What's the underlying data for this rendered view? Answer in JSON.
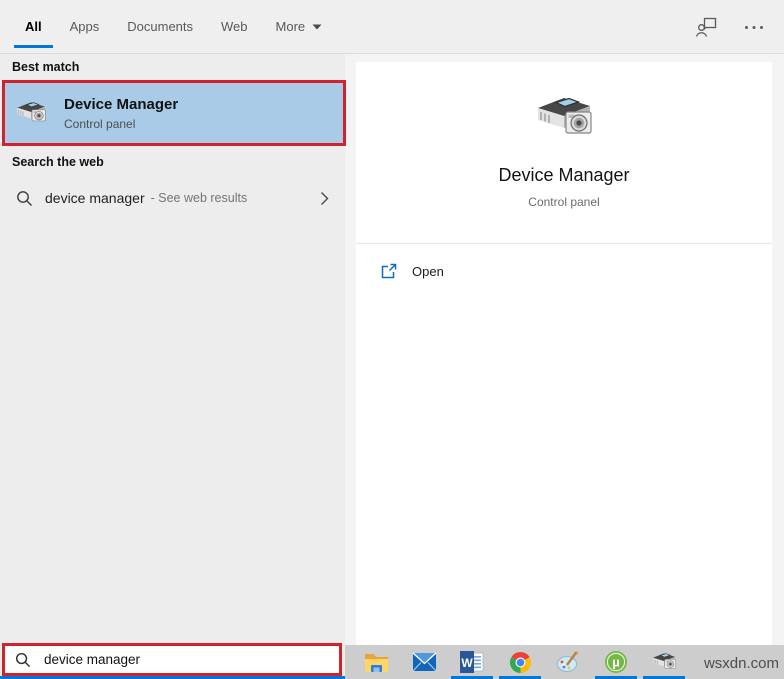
{
  "tabs": [
    {
      "label": "All",
      "active": true
    },
    {
      "label": "Apps",
      "active": false
    },
    {
      "label": "Documents",
      "active": false
    },
    {
      "label": "Web",
      "active": false
    },
    {
      "label": "More",
      "active": false,
      "dropdown": true
    }
  ],
  "topbar_icons": [
    {
      "name": "feedback-icon"
    },
    {
      "name": "ellipsis-icon"
    }
  ],
  "left_panel": {
    "best_match_header": "Best match",
    "best_match": {
      "icon": "device-manager-icon",
      "title": "Device Manager",
      "subtitle": "Control panel",
      "highlighted": true
    },
    "search_web_header": "Search the web",
    "web_suggestion": {
      "icon": "search-icon",
      "query": "device manager",
      "suffix": "- See web results",
      "chevron": "chevron-right-icon"
    }
  },
  "preview_panel": {
    "icon": "device-manager-icon",
    "title": "Device Manager",
    "subtitle": "Control panel",
    "actions": [
      {
        "icon": "open-icon",
        "label": "Open"
      }
    ]
  },
  "search_box": {
    "icon": "search-icon",
    "value": "device manager",
    "annotated": true
  },
  "taskbar": {
    "items": [
      {
        "name": "file-explorer-icon",
        "running": false
      },
      {
        "name": "mail-icon",
        "running": false
      },
      {
        "name": "word-icon",
        "running": true
      },
      {
        "name": "chrome-icon",
        "running": true
      },
      {
        "name": "paint3d-icon",
        "running": false
      },
      {
        "name": "utorrent-icon",
        "running": true
      },
      {
        "name": "device-manager-icon",
        "running": true
      }
    ],
    "watermark": "wsxdn.com"
  },
  "colors": {
    "accent_blue": "#0078d7",
    "highlight_blue": "#a9cbe8",
    "annotation_red": "#d0232e",
    "panel_gray": "#ededed",
    "taskbar_gray": "#cdcdcd",
    "card_white": "#ffffff"
  }
}
